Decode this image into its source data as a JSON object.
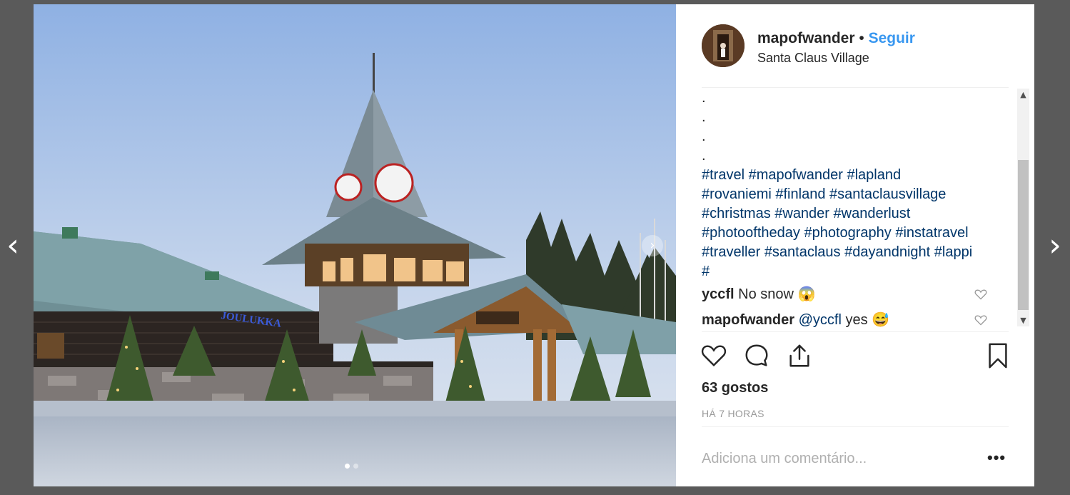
{
  "navigation": {
    "prev_glyph": "‹",
    "next_glyph": "›"
  },
  "photo": {
    "sign_text": "JOULUKKA",
    "next_glyph": "›",
    "slide_count": 2,
    "active_slide": 1
  },
  "post": {
    "username": "mapofwander",
    "separator": "•",
    "follow_label": "Seguir",
    "location": "Santa Claus Village",
    "caption_dots": [
      ".",
      ".",
      ".",
      "."
    ],
    "hashtag_lines": [
      "#travel #mapofwander #lapland",
      "#rovaniemi #finland #santaclausvillage",
      "#christmas #wander #wanderlust",
      "#photooftheday #photography #instatravel",
      "#traveller #santaclaus #dayandnight #lappi",
      "#"
    ],
    "comments": [
      {
        "user": "yccfl",
        "text": "No snow 😱",
        "mention": ""
      },
      {
        "user": "mapofwander",
        "text": "yes 😅",
        "mention": "@yccfl"
      }
    ],
    "likes": "63 gostos",
    "time": "HÁ 7 HORAS",
    "comment_placeholder": "Adiciona um comentário...",
    "more_glyph": "•••"
  },
  "scrollbar": {
    "up_glyph": "▲",
    "down_glyph": "▼"
  },
  "colors": {
    "link": "#3897f0",
    "hashtag": "#003569",
    "text": "#262626",
    "muted": "#999999"
  }
}
